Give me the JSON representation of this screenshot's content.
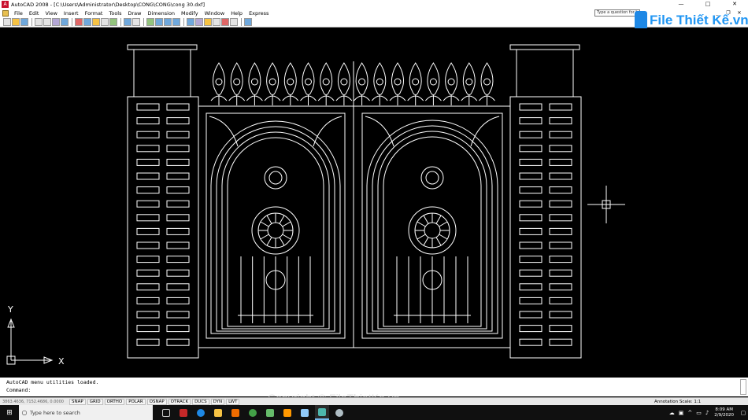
{
  "window": {
    "title": "AutoCAD 2008 - [C:\\Users\\Administrator\\Desktop\\CONG\\CONG\\cong 30.dxf]",
    "controls": {
      "minimize": "—",
      "maximize": "□",
      "close": "✕"
    }
  },
  "menu": {
    "items": [
      "File",
      "Edit",
      "View",
      "Insert",
      "Format",
      "Tools",
      "Draw",
      "Dimension",
      "Modify",
      "Window",
      "Help",
      "Express"
    ],
    "help_search_placeholder": "Type a question for help",
    "mdi_controls": {
      "minimize": "_",
      "restore": "❐",
      "close": "✕"
    }
  },
  "logo": {
    "text": "File Thiết Kế.vn"
  },
  "drawing": {
    "ucs_x_label": "X",
    "ucs_y_label": "Y"
  },
  "command": {
    "history": "AutoCAD menu utilities loaded.",
    "prompt": "Command:"
  },
  "status": {
    "coordinates": "3863.4636, 7152.4686, 0.0000",
    "toggles": [
      "SNAP",
      "GRID",
      "ORTHO",
      "POLAR",
      "OSNAP",
      "OTRACK",
      "DUCS",
      "DYN",
      "LWT"
    ],
    "annotation_scale_label": "Annotation Scale:",
    "annotation_scale_value": "1:1"
  },
  "watermark": {
    "text": "Copyright © FileThietKe.vn"
  },
  "taskbar": {
    "search_placeholder": "Type here to search",
    "time": "8:09 AM",
    "date": "2/9/2020"
  },
  "colors": {
    "drawing_background": "#000000",
    "cad_lines": "#ffffff",
    "logo_blue": "#2196f3",
    "taskbar": "#101010"
  }
}
